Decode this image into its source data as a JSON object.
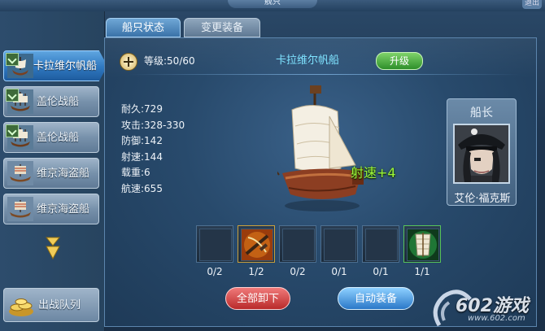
{
  "window": {
    "title": "舰只",
    "close_label": "退出"
  },
  "tabs": [
    {
      "label": "船只状态",
      "active": true
    },
    {
      "label": "变更装备",
      "active": false
    }
  ],
  "ship_list": [
    {
      "name": "卡拉维尔帆船",
      "active": true,
      "flagged": true
    },
    {
      "name": "盖伦战船",
      "active": false,
      "flagged": true
    },
    {
      "name": "盖伦战船",
      "active": false,
      "flagged": true
    },
    {
      "name": "维京海盗船",
      "active": false,
      "flagged": false
    },
    {
      "name": "维京海盗船",
      "active": false,
      "flagged": false
    }
  ],
  "fleet_button": {
    "label": "出战队列"
  },
  "ship": {
    "level_label": "等级:50/60",
    "name": "卡拉维尔帆船",
    "upgrade_label": "升级",
    "buff": "射速+4",
    "stats": [
      "耐久:729",
      "攻击:328-330",
      "防御:142",
      "射速:144",
      "载重:6",
      "航速:655"
    ]
  },
  "captain": {
    "title": "船长",
    "name": "艾伦·福克斯"
  },
  "equipment_slots": [
    {
      "count": "0/2",
      "item": "empty"
    },
    {
      "count": "1/2",
      "item": "crossbow"
    },
    {
      "count": "0/2",
      "item": "empty"
    },
    {
      "count": "0/1",
      "item": "empty"
    },
    {
      "count": "0/1",
      "item": "empty"
    },
    {
      "count": "1/1",
      "item": "sail"
    }
  ],
  "actions": {
    "unequip_all": "全部卸下",
    "auto_equip": "自动装备"
  },
  "watermark": {
    "brand": "602游戏",
    "url": "www.602.com"
  },
  "colors": {
    "ship_name": "#7fe3ff",
    "buff": "#9cf53a",
    "upgrade": "#2e8f2a",
    "unequip": "#b92a2a",
    "auto": "#2a78c8"
  }
}
